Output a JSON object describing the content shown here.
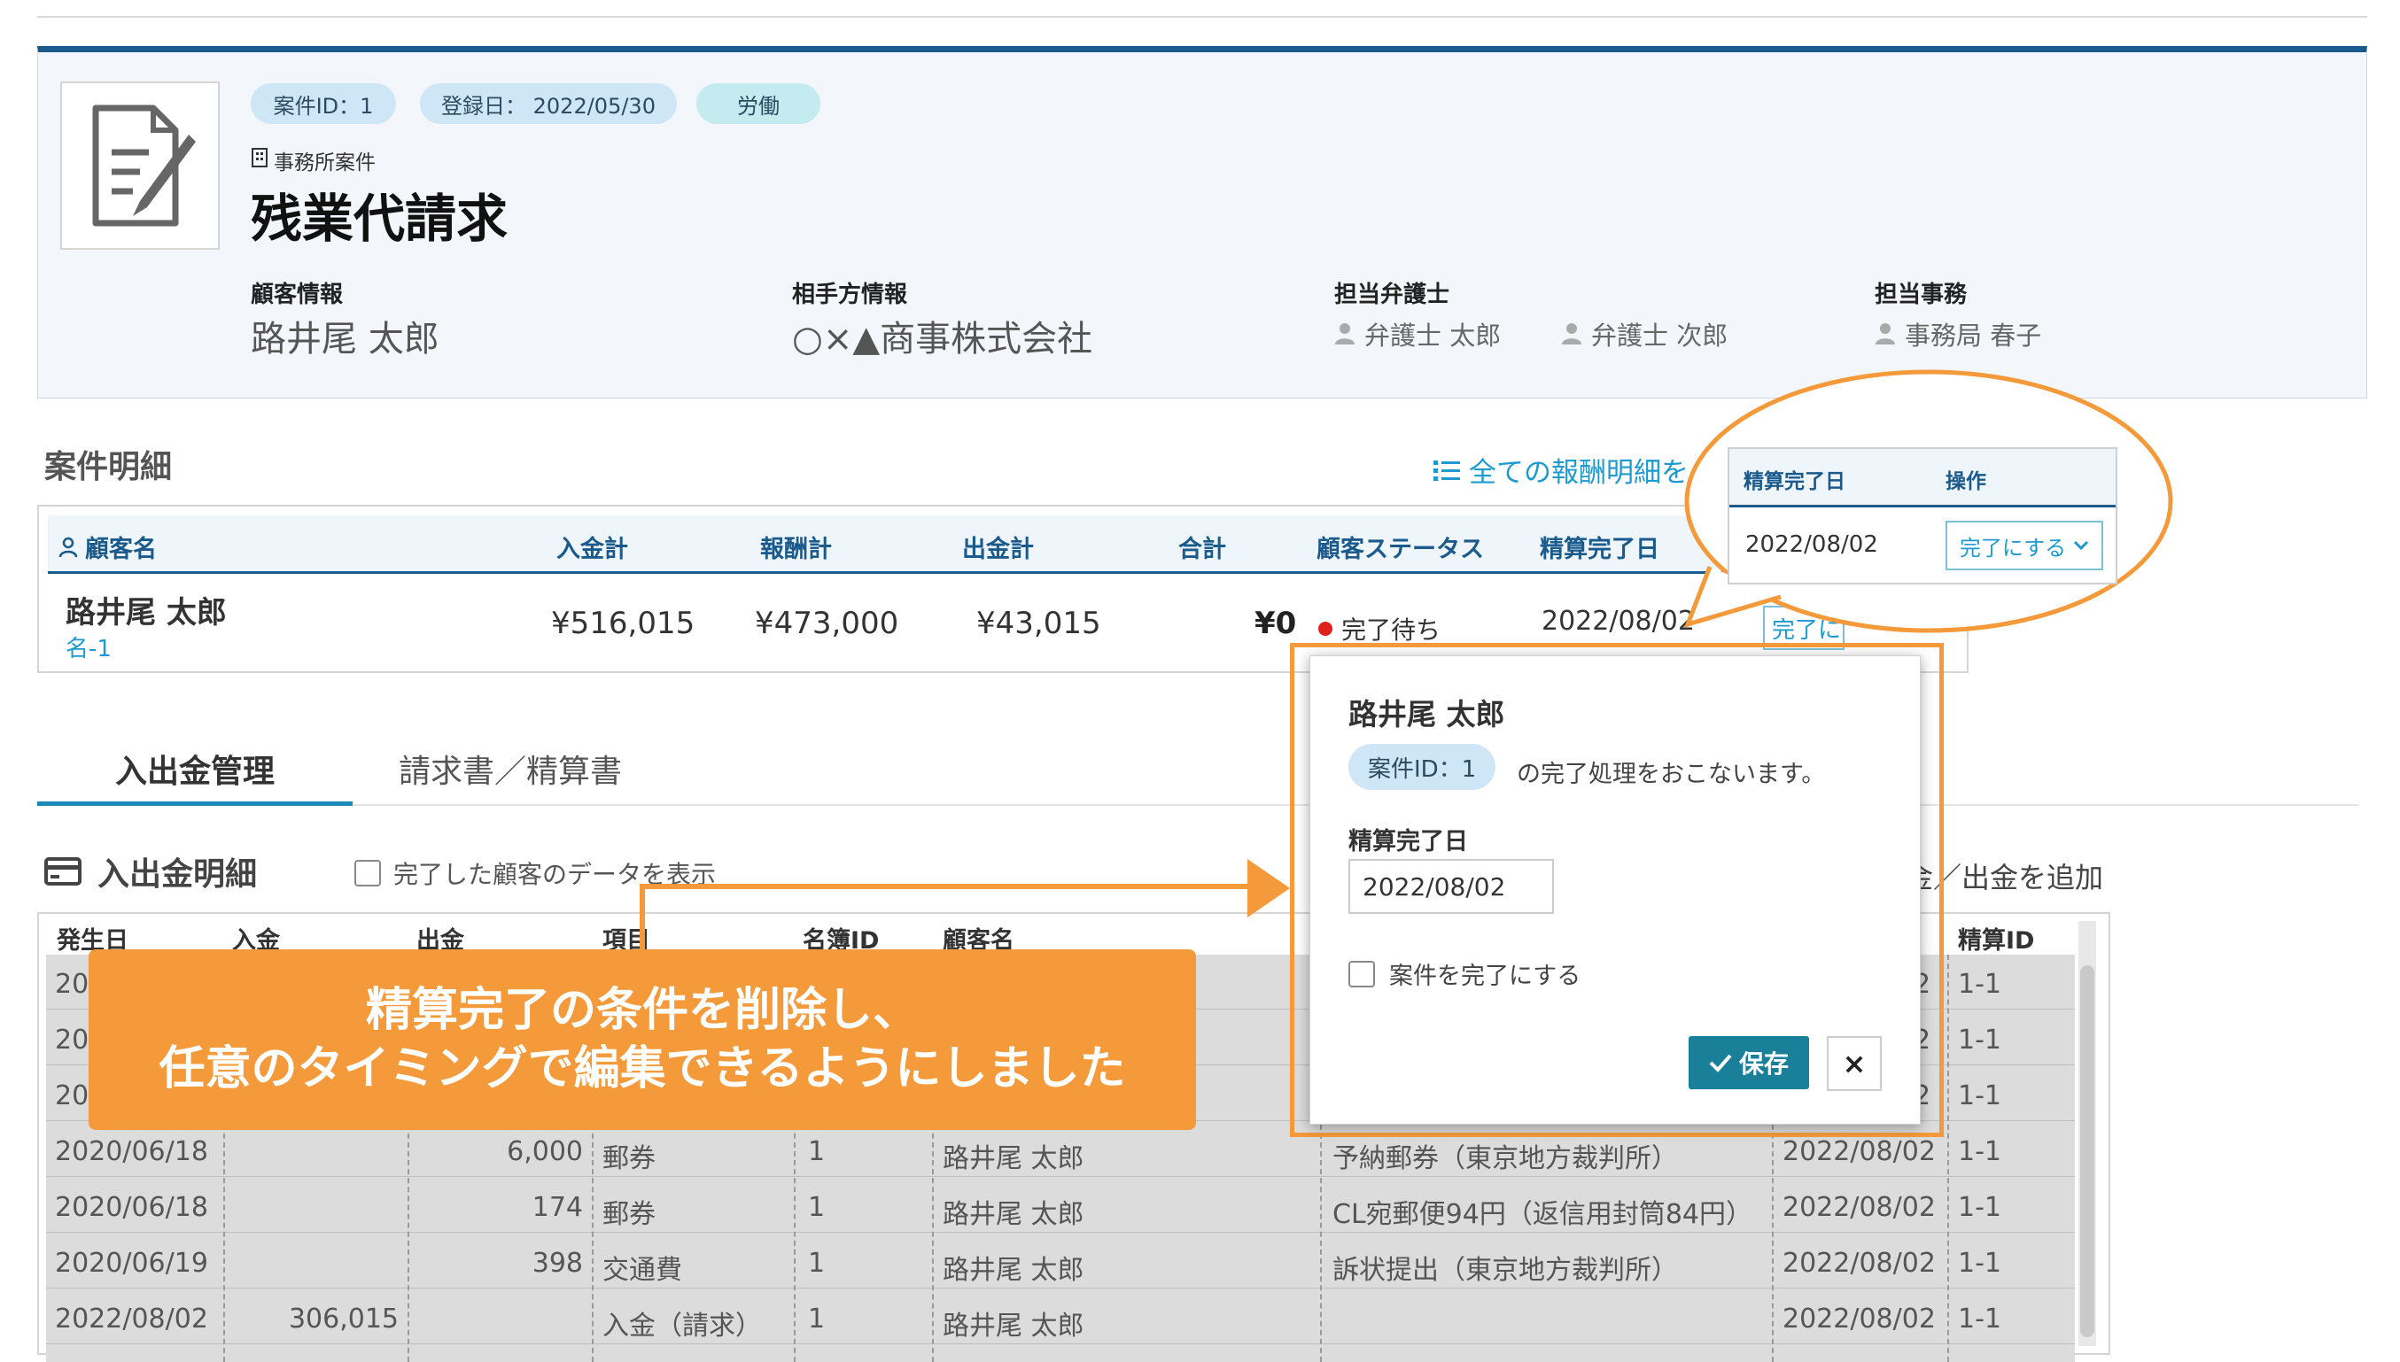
{
  "case": {
    "id_pill": "案件ID：1",
    "reg_pill": "登録日： 2022/05/30",
    "category_pill": "労働",
    "office_tag": "事務所案件",
    "title": "残業代請求",
    "customer_label": "顧客情報",
    "customer_value": "路井尾 太郎",
    "opponent_label": "相手方情報",
    "opponent_value": "○×▲商事株式会社",
    "lawyer_label": "担当弁護士",
    "lawyers": [
      "弁護士 太郎",
      "弁護士 次郎"
    ],
    "staff_label": "担当事務",
    "staff": "事務局 春子"
  },
  "section": {
    "title": "案件明細",
    "all_link": "全ての報酬明細を"
  },
  "summary": {
    "headers": [
      "顧客名",
      "入金計",
      "報酬計",
      "出金計",
      "合計",
      "顧客ステータス",
      "精算完了日"
    ],
    "row": {
      "name": "路井尾 太郎",
      "sub": "名-1",
      "deposit": "¥516,015",
      "fee": "¥473,000",
      "withdraw": "¥43,015",
      "total": "¥0",
      "status": "完了待ち",
      "settled": "2022/08/02",
      "button": "完了に"
    }
  },
  "tabs": [
    "入出金管理",
    "請求書／精算書"
  ],
  "ledger": {
    "title": "入出金明細",
    "show_done": "完了した顧客のデータを表示",
    "add_link": "金／出金を追加",
    "headers": [
      "発生日",
      "入金",
      "出金",
      "項目",
      "名簿ID",
      "顧客名",
      "精算ID"
    ],
    "partial_rows": [
      {
        "date": "20",
        "end": "2",
        "sid": "1-1"
      },
      {
        "date": "20",
        "end": "2",
        "sid": "1-1"
      },
      {
        "date": "20",
        "end": "2",
        "sid": "1-1"
      }
    ],
    "rows": [
      {
        "date": "2020/06/18",
        "deposit": "",
        "withdraw": "6,000",
        "item": "郵券",
        "nid": "1",
        "name": "路井尾 太郎",
        "memo": "予納郵券（東京地方裁判所）",
        "settled": "2022/08/02",
        "sid": "1-1"
      },
      {
        "date": "2020/06/18",
        "deposit": "",
        "withdraw": "174",
        "item": "郵券",
        "nid": "1",
        "name": "路井尾 太郎",
        "memo": "CL宛郵便94円（返信用封筒84円）",
        "settled": "2022/08/02",
        "sid": "1-1"
      },
      {
        "date": "2020/06/19",
        "deposit": "",
        "withdraw": "398",
        "item": "交通費",
        "nid": "1",
        "name": "路井尾 太郎",
        "memo": "訴状提出（東京地方裁判所）",
        "settled": "2022/08/02",
        "sid": "1-1"
      },
      {
        "date": "2022/08/02",
        "deposit": "306,015",
        "withdraw": "",
        "item": "入金（請求）",
        "nid": "1",
        "name": "路井尾 太郎",
        "memo": "",
        "settled": "2022/08/02",
        "sid": "1-1"
      }
    ]
  },
  "callout": {
    "line1": "精算完了の条件を削除し、",
    "line2": "任意のタイミングで編集できるようにしました"
  },
  "popup": {
    "name": "路井尾 太郎",
    "pill": "案件ID：1",
    "message": "の完了処理をおこないます。",
    "date_label": "精算完了日",
    "date_value": "2022/08/02",
    "checkbox_label": "案件を完了にする",
    "save": "保存",
    "close": "×"
  },
  "zoom": {
    "col1": "精算完了日",
    "col2": "操作",
    "date": "2022/08/02",
    "button": "完了にする"
  },
  "colors": {
    "accent_dark": "#1a5a8c",
    "link": "#1d9bd1",
    "callout": "#f59a3a",
    "save": "#1a7f99",
    "status_dot": "#e0201b"
  }
}
